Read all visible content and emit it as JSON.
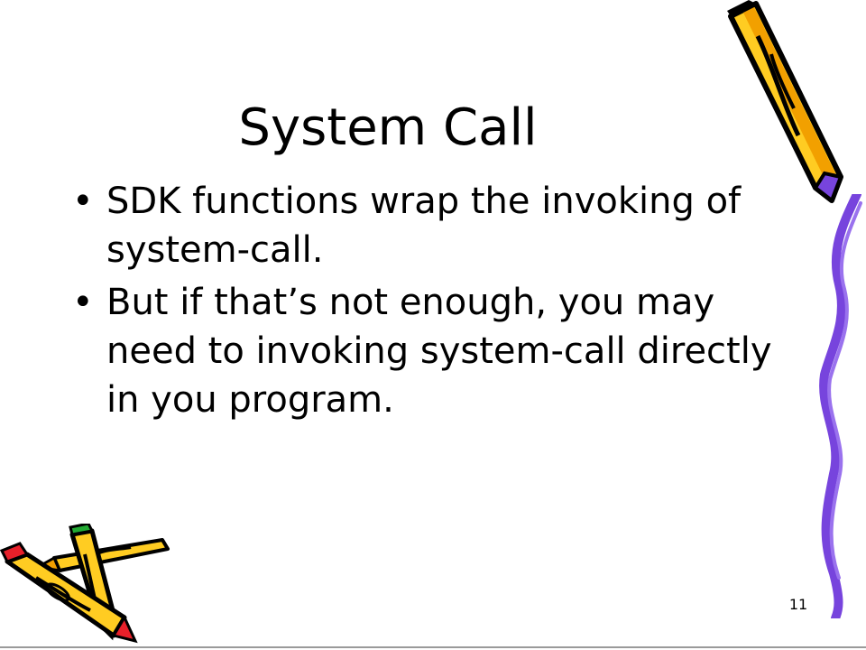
{
  "slide": {
    "title": "System Call",
    "bullets": [
      "SDK functions wrap the invoking of system-call.",
      "But if that’s not enough, you may need to invoking system-call directly in you program."
    ],
    "bullet_symbol": "•",
    "slide_number": "11"
  },
  "colors": {
    "pencil_yellow": "#FFCC22",
    "pencil_orange": "#F2A000",
    "purple_ribbon": "#7744DD",
    "eraser_red": "#E8202A",
    "eraser_green": "#22AA33",
    "outline": "#000000"
  }
}
